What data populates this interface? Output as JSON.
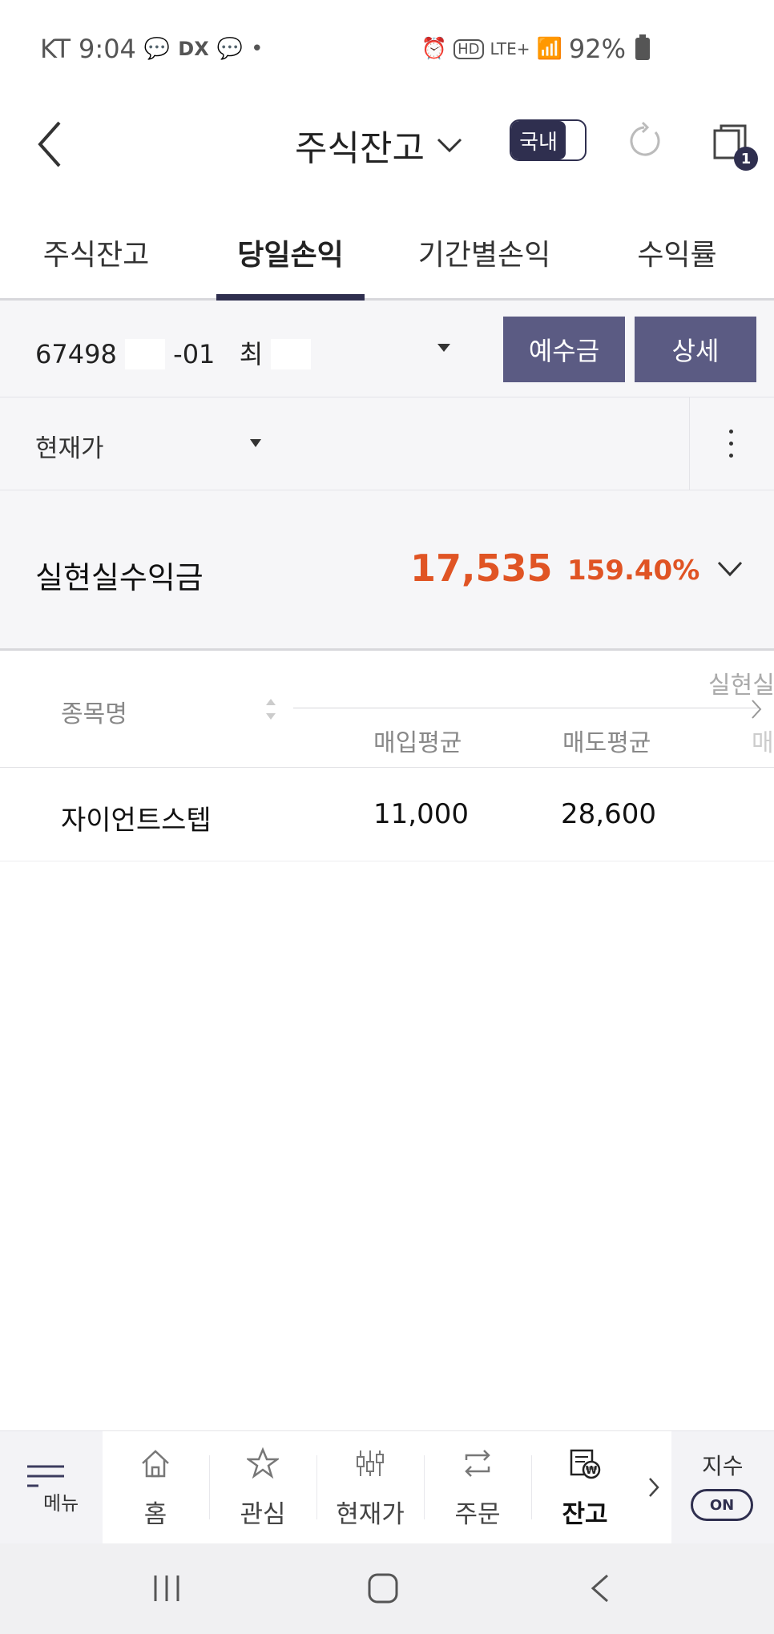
{
  "status_bar": {
    "carrier": "KT",
    "time": "9:04",
    "network": "LTE+",
    "battery": "92%"
  },
  "header": {
    "title": "주식잔고",
    "market_toggle": "국내",
    "window_badge": "1"
  },
  "tabs": [
    {
      "label": "주식잔고",
      "active": false
    },
    {
      "label": "당일손익",
      "active": true
    },
    {
      "label": "기간별손익",
      "active": false
    },
    {
      "label": "수익률",
      "active": false
    }
  ],
  "account": {
    "number_prefix": "67498",
    "number_suffix": "-01",
    "owner_initial": "최",
    "deposit_button": "예수금",
    "detail_button": "상세"
  },
  "filter": {
    "selected": "현재가"
  },
  "summary": {
    "label": "실현실수익금",
    "amount": "17,535",
    "rate": "159.40%",
    "accent_color": "#e05424"
  },
  "table": {
    "headers": {
      "name": "종목명",
      "col_realized": "실현실",
      "buy_avg": "매입평균",
      "sell_avg": "매도평균",
      "col_cut": "매"
    },
    "rows": [
      {
        "name": "자이언트스텝",
        "buy_avg": "11,000",
        "sell_avg": "28,600"
      }
    ]
  },
  "bottom_nav": {
    "menu": "메뉴",
    "items": [
      {
        "label": "홈",
        "icon": "home-icon"
      },
      {
        "label": "관심",
        "icon": "star-icon"
      },
      {
        "label": "현재가",
        "icon": "candlestick-icon"
      },
      {
        "label": "주문",
        "icon": "exchange-icon"
      },
      {
        "label": "잔고",
        "icon": "balance-won-icon",
        "active": true
      }
    ],
    "index_label": "지수",
    "index_toggle": "ON"
  },
  "colors": {
    "brand_dark": "#2f2f4f",
    "button": "#5b5b83",
    "profit": "#e05424"
  }
}
